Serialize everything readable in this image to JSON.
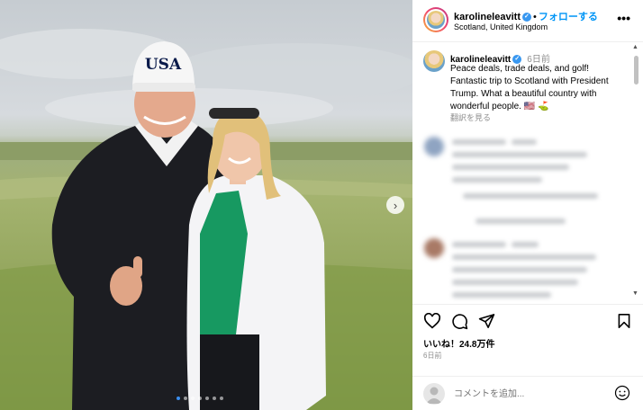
{
  "header": {
    "username": "karolineleavitt",
    "separator": "•",
    "follow_label": "フォローする",
    "location": "Scotland, United Kingdom",
    "more_label": "•••"
  },
  "caption": {
    "username": "karolineleavitt",
    "time": "6日前",
    "text": "Peace deals, trade deals, and golf! Fantastic trip to Scotland with President Trump. What a beautiful country with wonderful people. 🇺🇸 ⛳",
    "translate_label": "翻訳を見る"
  },
  "photo": {
    "cap_text": "USA",
    "next_label": "›",
    "carousel_count": 7,
    "carousel_active": 1
  },
  "actions": {
    "likes": "いいね！24.8万件",
    "time": "6日前"
  },
  "comment": {
    "placeholder": "コメントを追加..."
  },
  "colors": {
    "accent": "#0095f6",
    "verified": "#3897f0"
  }
}
